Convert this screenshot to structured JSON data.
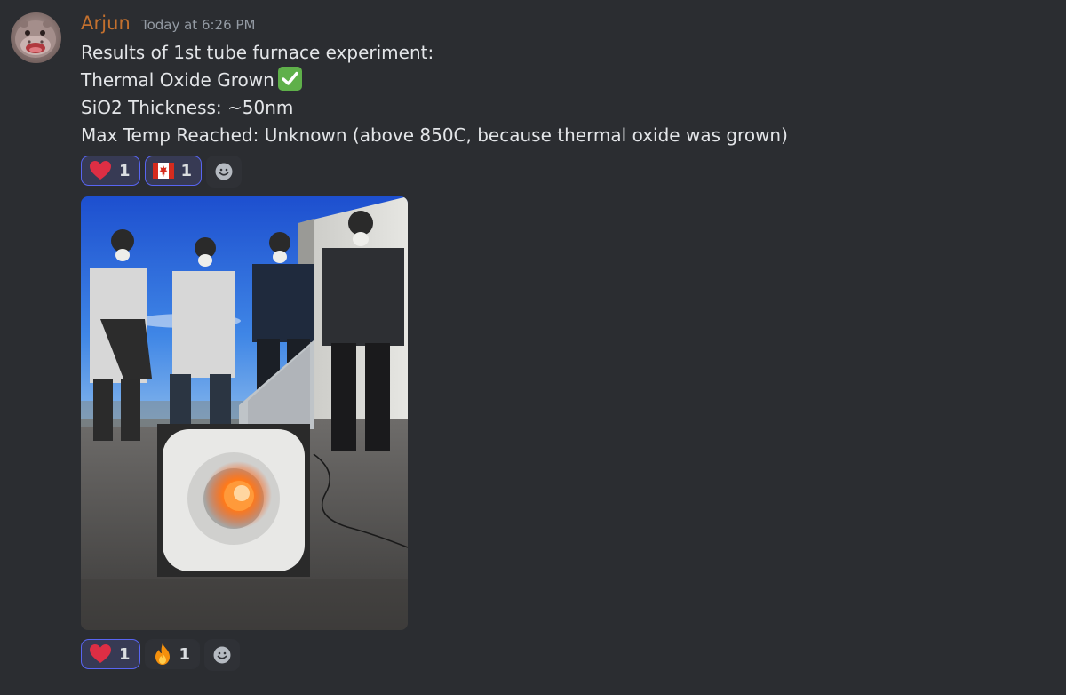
{
  "message": {
    "author": "Arjun",
    "timestamp": "Today at 6:26 PM",
    "author_color": "#c3702e",
    "avatar_icon": "hippo-avatar",
    "lines": [
      "Results of 1st tube furnace experiment:",
      "Thermal Oxide Grown",
      "SiO2 Thickness: ~50nm",
      "Max Temp Reached: Unknown (above 850C, because thermal oxide was grown)"
    ],
    "inline_emoji": "white-check-mark"
  },
  "reactions_top": [
    {
      "emoji": "heart",
      "count": "1",
      "selected": true
    },
    {
      "emoji": "flag-canada",
      "count": "1",
      "selected": true
    }
  ],
  "attachment": {
    "type": "image",
    "description_icon": "furnace-photo"
  },
  "reactions_bottom": [
    {
      "emoji": "heart",
      "count": "1",
      "selected": true
    },
    {
      "emoji": "fire",
      "count": "1",
      "selected": false
    }
  ],
  "colors": {
    "background": "#2b2d31",
    "reaction_selected_bg": "#373a54",
    "reaction_selected_border": "#5865f2",
    "timestamp": "#949ba4"
  }
}
